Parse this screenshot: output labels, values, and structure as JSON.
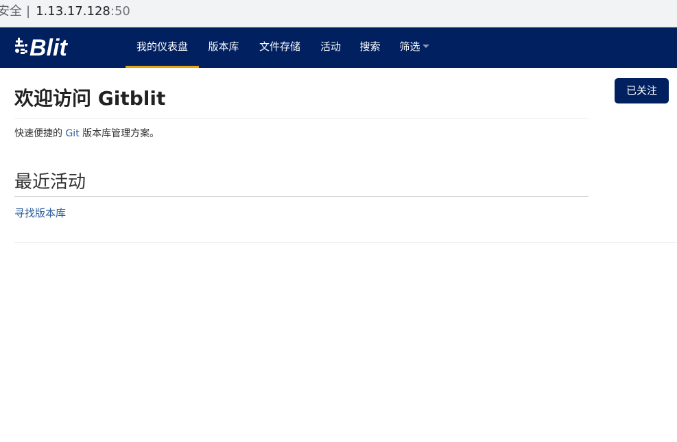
{
  "browser": {
    "security_label": "安全",
    "separator": "|",
    "host": "1.13.17.128",
    "port": ":50"
  },
  "brand": {
    "logo_icon": "gitblit-logo-icon",
    "logo_text": "Blit"
  },
  "nav": {
    "items": [
      {
        "label": "我的仪表盘",
        "active": true
      },
      {
        "label": "版本库"
      },
      {
        "label": "文件存储"
      },
      {
        "label": "活动"
      },
      {
        "label": "搜索"
      },
      {
        "label": "筛选",
        "has_dropdown": true
      }
    ]
  },
  "actions": {
    "follow_label": "已关注"
  },
  "main": {
    "title": "欢迎访问 Gitblit",
    "tagline_prefix": "快速便捷的 ",
    "tagline_link": "Git",
    "tagline_suffix": " 版本库管理方案。",
    "section_title": "最近活动",
    "find_repos_link": "寻找版本库"
  },
  "colors": {
    "navbar_bg": "#002060",
    "active_underline": "#e8a317",
    "link": "#2f5f9e"
  }
}
